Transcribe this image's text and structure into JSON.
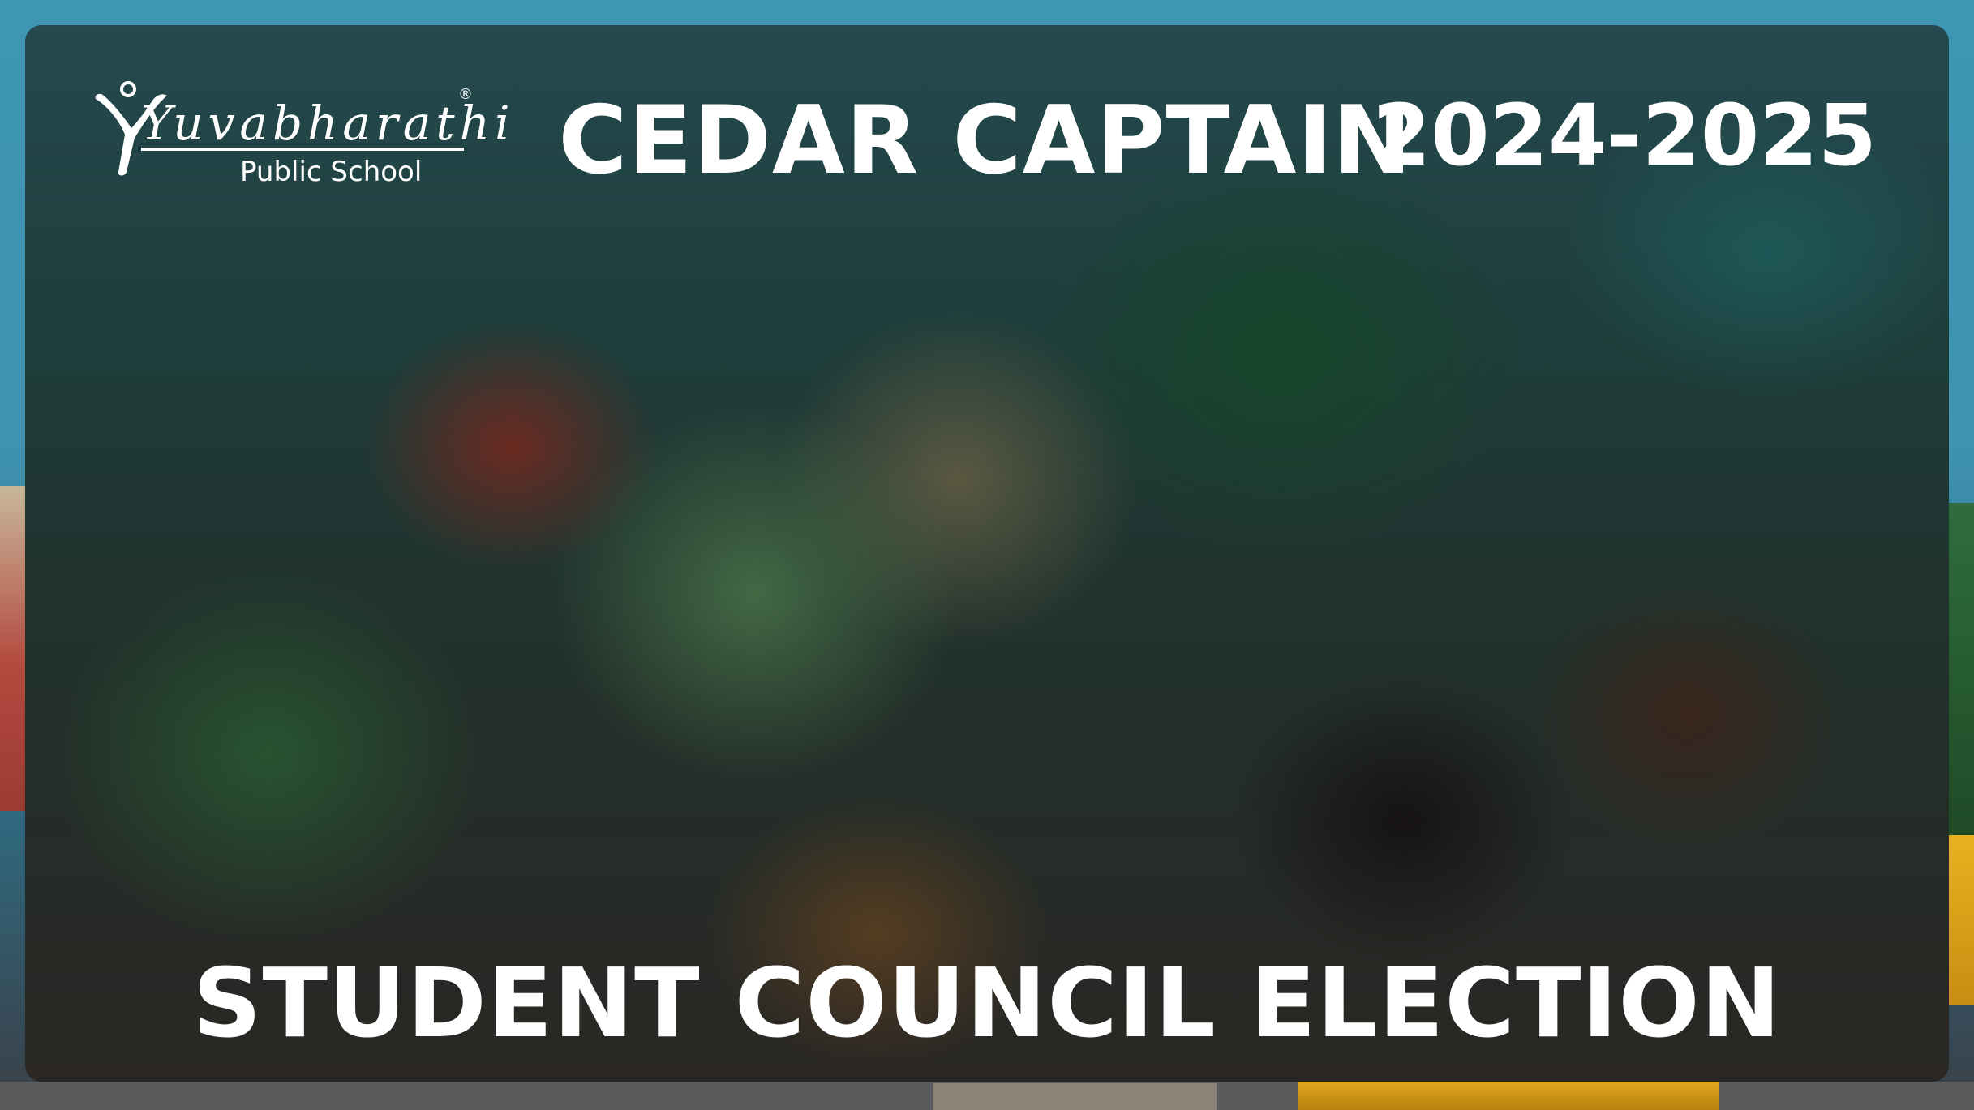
{
  "logo": {
    "name": "Yuvabharathi",
    "registered_mark": "®",
    "subtitle": "Public School"
  },
  "header": {
    "title": "CEDAR CAPTAIN",
    "year": "2024-2025"
  },
  "footer": {
    "title": "STUDENT COUNCIL ELECTION"
  },
  "colors": {
    "text": "#ffffff",
    "sky": "#3e95b4"
  }
}
